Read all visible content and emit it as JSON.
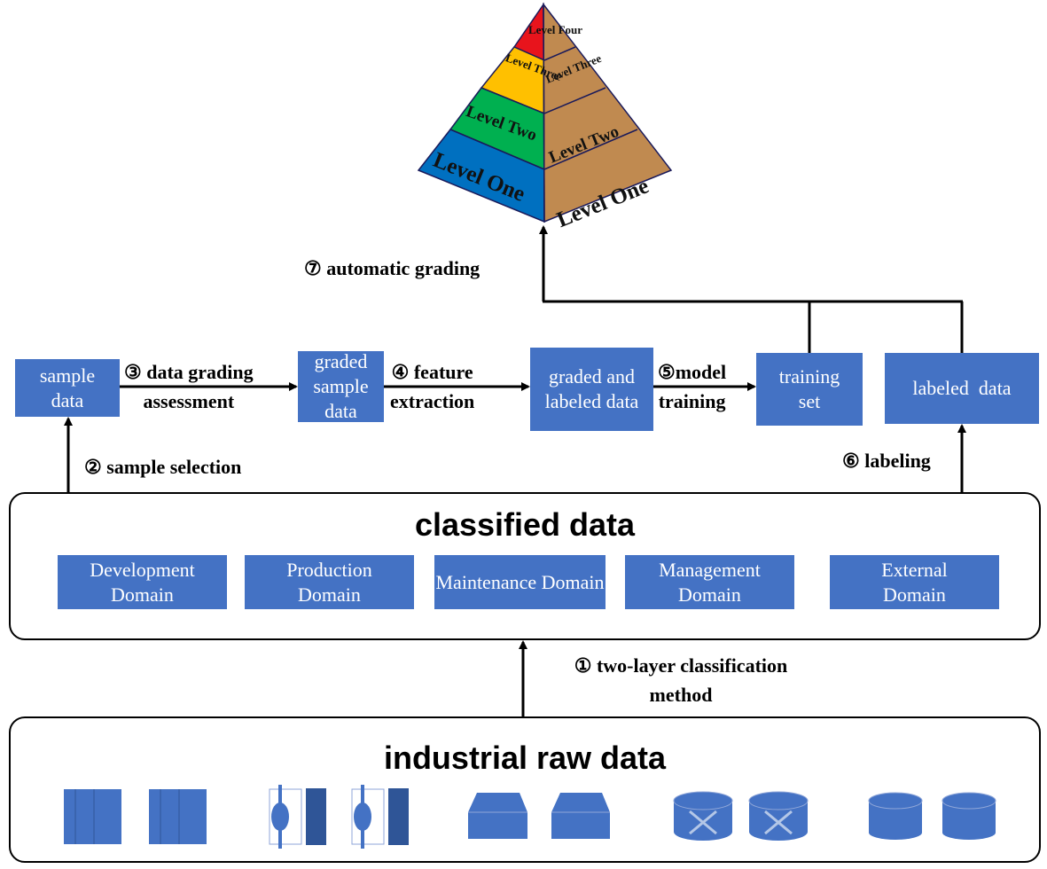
{
  "pyramid": {
    "levels": [
      "Level One",
      "Level Two",
      "Level Three",
      "Level Four"
    ],
    "colors": {
      "level_one": "#0070c0",
      "level_two": "#00b050",
      "level_three": "#ffc000",
      "level_four": "#e8141c",
      "side": "#c08a50"
    }
  },
  "steps": {
    "s1": {
      "num": "①",
      "text": "two-layer classification",
      "text2": "method"
    },
    "s2": {
      "num": "②",
      "text": "sample selection"
    },
    "s3": {
      "num": "③",
      "text": "data grading",
      "text2": "assessment"
    },
    "s4": {
      "num": "④",
      "text": "feature",
      "text2": "extraction"
    },
    "s5": {
      "num": "⑤",
      "text": "model",
      "text2": "training"
    },
    "s6": {
      "num": "⑥",
      "text": "labeling"
    },
    "s7": {
      "num": "⑦",
      "text": "automatic grading"
    }
  },
  "boxes": {
    "sample_data": "sample data",
    "graded_sample_data": "graded sample data",
    "graded_labeled_data": "graded and labeled data",
    "training_set": "training set",
    "labeled_data": "labeled  data"
  },
  "classified": {
    "title": "classified data",
    "domains": [
      "Development Domain",
      "Production Domain",
      "Maintenance Domain",
      "Management Domain",
      "External Domain"
    ]
  },
  "raw": {
    "title": "industrial raw data",
    "icons": [
      "server-icon",
      "server-icon",
      "machine-icon",
      "machine-icon",
      "box-icon",
      "box-icon",
      "router-icon",
      "router-icon",
      "database-icon",
      "database-icon"
    ]
  },
  "colors": {
    "box": "#4472c4"
  }
}
